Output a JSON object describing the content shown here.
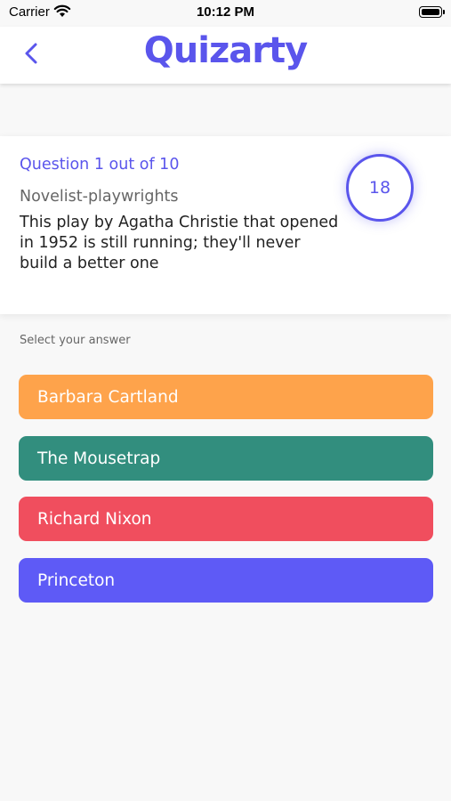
{
  "status_bar": {
    "carrier": "Carrier",
    "time": "10:12 PM"
  },
  "header": {
    "back_icon": "chevron-left-icon",
    "brand": "Quizarty"
  },
  "question": {
    "progress": "Question 1 out of 10",
    "category": "Novelist-playwrights",
    "text": "This play by Agatha Christie that opened in 1952 is still running; they'll never build a better one",
    "timer": "18"
  },
  "answers": {
    "label": "Select your answer",
    "options": [
      {
        "label": "Barbara Cartland",
        "color": "#fea34b"
      },
      {
        "label": "The Mousetrap",
        "color": "#328e7e"
      },
      {
        "label": "Richard Nixon",
        "color": "#f04e5e"
      },
      {
        "label": "Princeton",
        "color": "#5e5af6"
      }
    ]
  },
  "colors": {
    "accent": "#5a55ec"
  }
}
